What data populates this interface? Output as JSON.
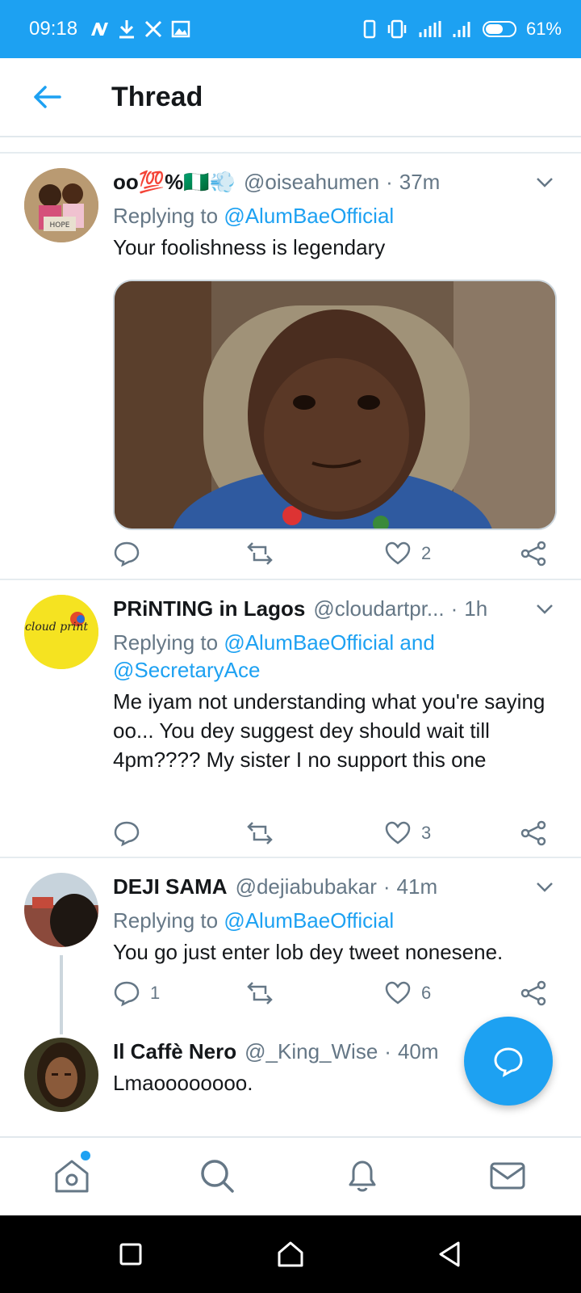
{
  "status_bar": {
    "time": "09:18",
    "battery": "61%",
    "left_icons": [
      "notification-n-icon",
      "download-icon",
      "x-icon",
      "image-icon"
    ],
    "right_icons": [
      "screen-icon",
      "vibrate-icon",
      "signal-icon",
      "signal-icon",
      "battery-icon"
    ]
  },
  "header": {
    "title": "Thread"
  },
  "tweets": [
    {
      "name": "oo💯%🇳🇬💨",
      "handle": "@oiseahumen",
      "sep": "·",
      "time": "37m",
      "reply_prefix": "Replying to",
      "reply_link": "@AlumBaeOfficial",
      "text": "Your foolishness is legendary",
      "has_media": true,
      "reply_count": "",
      "retweet_count": "",
      "like_count": "2"
    },
    {
      "name": "PRiNTING in Lagos",
      "handle": "@cloudartpr...",
      "sep": "·",
      "time": "1h",
      "reply_prefix": "Replying to",
      "reply_link": "@AlumBaeOfficial and @SecretaryAce",
      "text": "Me iyam not understanding what you're saying oo... You dey suggest dey should wait till 4pm???? My sister I no support this one",
      "reply_count": "",
      "retweet_count": "",
      "like_count": "3"
    },
    {
      "name": "DEJI SAMA",
      "handle": "@dejiabubakar",
      "sep": "·",
      "time": "41m",
      "reply_prefix": "Replying to",
      "reply_link": "@AlumBaeOfficial",
      "text": "You go just enter lob dey tweet nonesene.",
      "reply_count": "1",
      "retweet_count": "",
      "like_count": "6"
    },
    {
      "name": "Il Caffè Nero",
      "handle": "@_King_Wise",
      "sep": "·",
      "time": "40m",
      "text": "Lmaoooooooo."
    }
  ],
  "avatars": {
    "t1_sign": "HOPE",
    "t2_logo": "cloud print"
  },
  "fab": {
    "icon": "compose-reply-icon"
  },
  "bottom_nav": [
    "home-icon",
    "search-icon",
    "notifications-icon",
    "messages-icon"
  ],
  "system_nav": [
    "recents-icon",
    "home-icon",
    "back-icon"
  ],
  "colors": {
    "accent": "#1da1f2",
    "text": "#14171a",
    "muted": "#657786",
    "divider": "#e6ecf0"
  }
}
